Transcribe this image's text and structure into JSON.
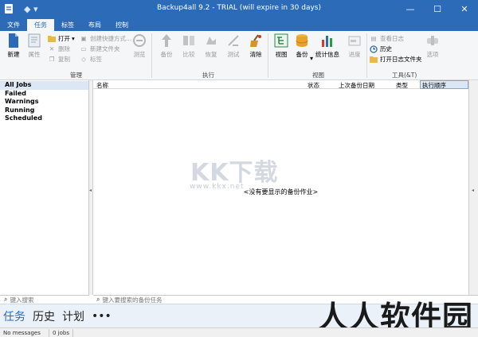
{
  "window": {
    "title": "Backup4all 9.2 - TRIAL (will expire in 30 days)",
    "controls": [
      "—",
      "☐",
      "✕"
    ]
  },
  "ribbon_tabs": [
    "文件",
    "任务",
    "标签",
    "布局",
    "控制"
  ],
  "ribbon": {
    "manage": {
      "group_label": "管理",
      "new": "新建",
      "properties": "属性",
      "open": "打开",
      "delete": "删除",
      "copy": "复制",
      "create_shortcut": "创建快捷方式...",
      "new_folder": "新建文件夹",
      "tag": "标签"
    },
    "execute": {
      "group_label": "执行",
      "browse": "测览",
      "backup": "备份",
      "compare": "比较",
      "restore": "恢复",
      "recover": "测试",
      "cleanup": "清除"
    },
    "view": {
      "group_label": "视图",
      "mirror": "视图",
      "catalog": "备份",
      "stats": "统计信息",
      "history": "进度"
    },
    "tools": {
      "group_label": "工具(&T)",
      "view_log": "查看日志",
      "history": "历史",
      "open_log_folder": "打开日志文件夹",
      "settings": "选项"
    }
  },
  "filters": [
    "All Jobs",
    "Failed",
    "Warnings",
    "Running",
    "Scheduled"
  ],
  "grid": {
    "columns": [
      "名称",
      "状态",
      "上次备份日期",
      "类型",
      "执行顺序"
    ],
    "empty_message": "<没有要显示的备份作业>"
  },
  "watermark_text": "KK下载",
  "watermark_url": "www.kkx.net",
  "search": {
    "left_placeholder": "键入搜索",
    "main_placeholder": "键入要搜索的备份任务"
  },
  "bottom_nav": [
    "任务",
    "历史",
    "计划",
    "•••"
  ],
  "corner_watermark": "人人软件园",
  "status": {
    "messages": "No messages",
    "jobs": "0 jobs"
  }
}
